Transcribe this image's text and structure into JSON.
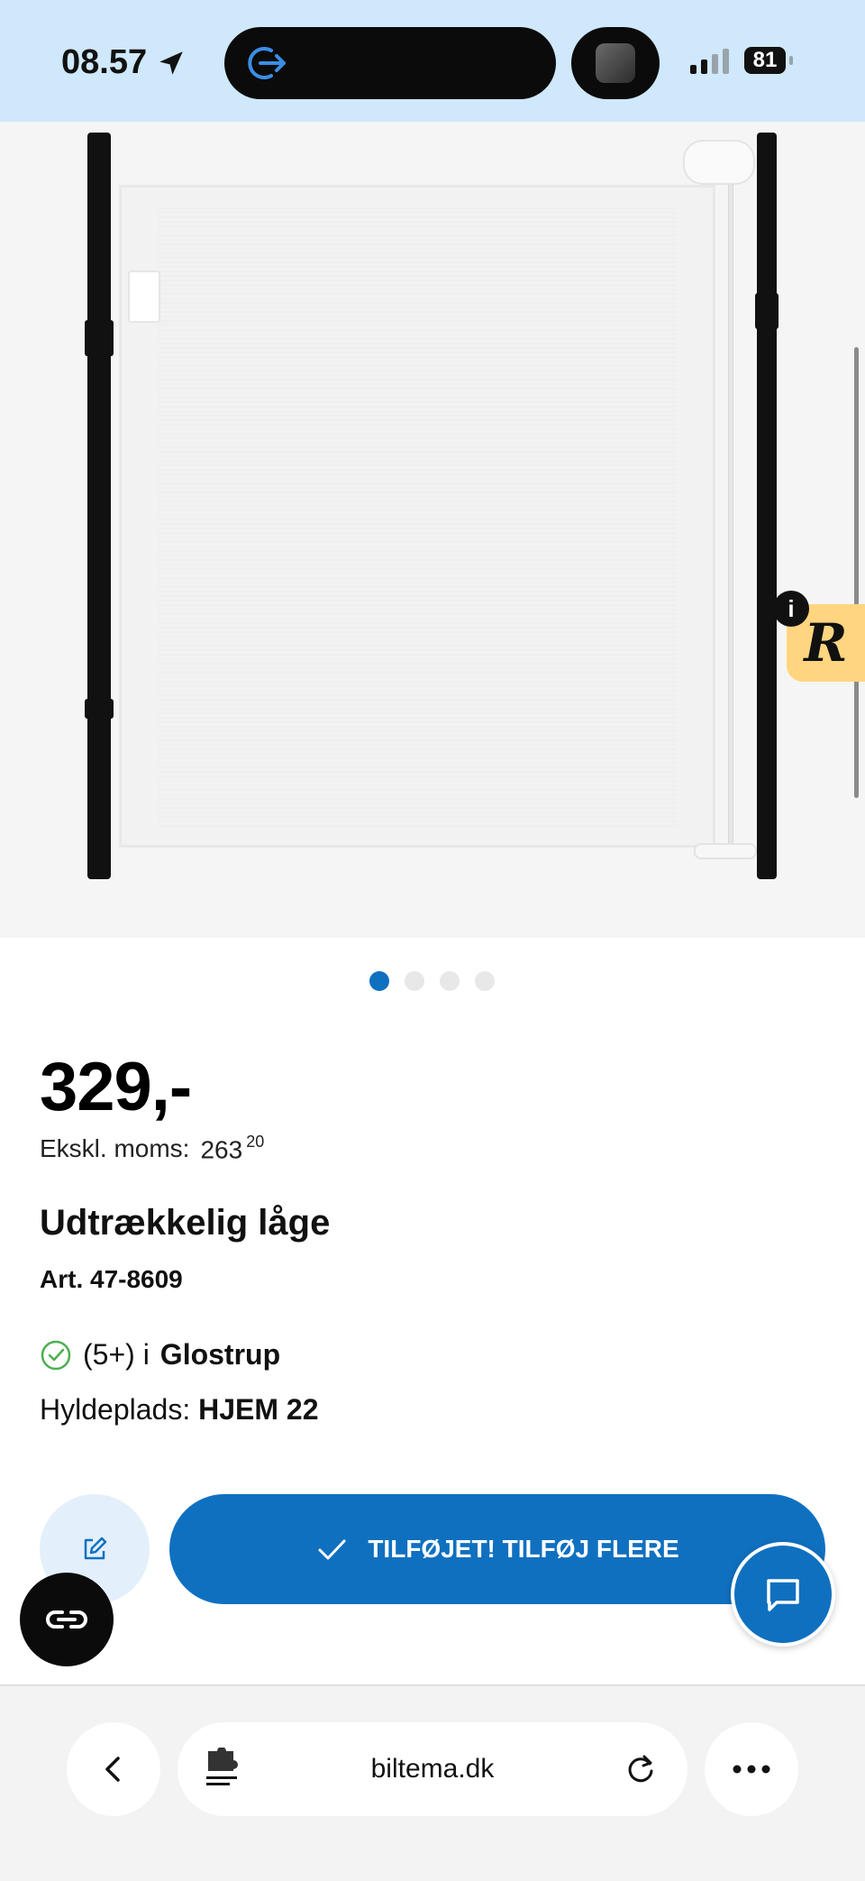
{
  "status_bar": {
    "time": "08.57",
    "battery": "81"
  },
  "product": {
    "price": "329,-",
    "ex_vat_label": "Ekskl. moms:",
    "ex_vat_main": "263",
    "ex_vat_decimals": "20",
    "title": "Udtrækkelig låge",
    "article": "Art. 47-8609",
    "stock_count": "(5+) i",
    "stock_store": "Glostrup",
    "shelf_label": "Hyldeplads:",
    "shelf_location": "HJEM 22"
  },
  "gallery": {
    "total_images": 4,
    "active_index": 0
  },
  "actions": {
    "added_label": "TILFØJET! TILFØJ FLERE",
    "edit_icon": "edit-icon",
    "chat_icon": "chat-icon",
    "link_icon": "link-icon"
  },
  "floating_badge": {
    "letter": "R",
    "info": "i"
  },
  "browser": {
    "url": "biltema.dk"
  },
  "colors": {
    "accent": "#1070c0",
    "status_bar": "#cfe8fb",
    "badge": "#ffd580",
    "check_green": "#4caf50"
  }
}
